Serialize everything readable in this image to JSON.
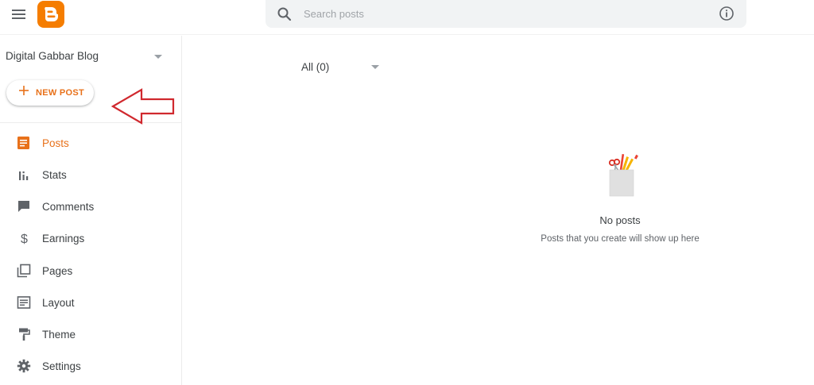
{
  "header": {
    "search_placeholder": "Search posts"
  },
  "sidebar": {
    "blog_name": "Digital Gabbar Blog",
    "new_post_label": "NEW POST",
    "items": [
      {
        "label": "Posts",
        "icon": "posts-icon",
        "active": true
      },
      {
        "label": "Stats",
        "icon": "stats-icon",
        "active": false
      },
      {
        "label": "Comments",
        "icon": "comments-icon",
        "active": false
      },
      {
        "label": "Earnings",
        "icon": "dollar-icon",
        "active": false
      },
      {
        "label": "Pages",
        "icon": "pages-icon",
        "active": false
      },
      {
        "label": "Layout",
        "icon": "layout-icon",
        "active": false
      },
      {
        "label": "Theme",
        "icon": "paint-roller-icon",
        "active": false
      },
      {
        "label": "Settings",
        "icon": "gear-icon",
        "active": false
      }
    ]
  },
  "main": {
    "filter_label": "All (0)",
    "empty_title": "No posts",
    "empty_subtitle": "Posts that you create will show up here"
  },
  "colors": {
    "accent": "#e8711a",
    "logo": "#f57d00",
    "annotation_arrow": "#d0282e",
    "icon": "#5f6368"
  }
}
